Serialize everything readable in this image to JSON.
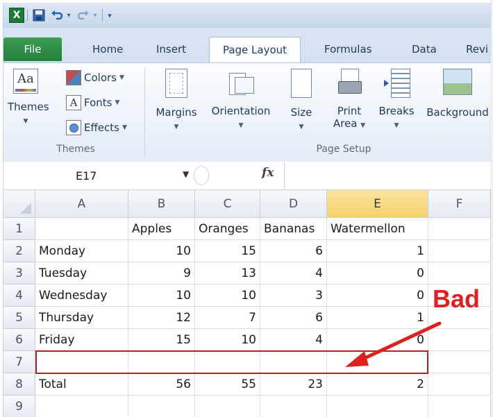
{
  "title_bar": {
    "redo_dropdown": "▾",
    "qat_customize": "▾"
  },
  "tabs": [
    {
      "id": "file",
      "label": "File"
    },
    {
      "id": "home",
      "label": "Home"
    },
    {
      "id": "insert",
      "label": "Insert"
    },
    {
      "id": "pagelayout",
      "label": "Page Layout"
    },
    {
      "id": "formulas",
      "label": "Formulas"
    },
    {
      "id": "data",
      "label": "Data"
    },
    {
      "id": "review",
      "label": "Revi"
    }
  ],
  "ribbon": {
    "themes_group": {
      "label": "Themes",
      "themes_button": "Themes",
      "colors": "Colors",
      "fonts": "Fonts",
      "effects": "Effects"
    },
    "page_setup_group": {
      "label": "Page Setup",
      "margins": "Margins",
      "orientation": "Orientation",
      "size": "Size",
      "print_area_line1": "Print",
      "print_area_line2": "Area",
      "breaks": "Breaks",
      "background": "Background"
    }
  },
  "formula_bar": {
    "name_box": "E17",
    "fx": "fx",
    "formula": ""
  },
  "sheet": {
    "columns": [
      "A",
      "B",
      "C",
      "D",
      "E",
      "F"
    ],
    "selected_column": "E",
    "rows": [
      {
        "n": "1",
        "a": "",
        "b": "Apples",
        "c": "Oranges",
        "d": "Bananas",
        "e": "Watermellon"
      },
      {
        "n": "2",
        "a": "Monday",
        "b": "10",
        "c": "15",
        "d": "6",
        "e": "1"
      },
      {
        "n": "3",
        "a": "Tuesday",
        "b": "9",
        "c": "13",
        "d": "4",
        "e": "0"
      },
      {
        "n": "4",
        "a": "Wednesday",
        "b": "10",
        "c": "10",
        "d": "3",
        "e": "0"
      },
      {
        "n": "5",
        "a": "Thursday",
        "b": "12",
        "c": "7",
        "d": "6",
        "e": "1"
      },
      {
        "n": "6",
        "a": "Friday",
        "b": "15",
        "c": "10",
        "d": "4",
        "e": "0"
      },
      {
        "n": "7",
        "a": "",
        "b": "",
        "c": "",
        "d": "",
        "e": ""
      },
      {
        "n": "8",
        "a": "Total",
        "b": "56",
        "c": "55",
        "d": "23",
        "e": "2"
      },
      {
        "n": "9",
        "a": "",
        "b": "",
        "c": "",
        "d": "",
        "e": ""
      }
    ]
  },
  "annotation": {
    "text": "Bad",
    "color": "#e02020"
  }
}
